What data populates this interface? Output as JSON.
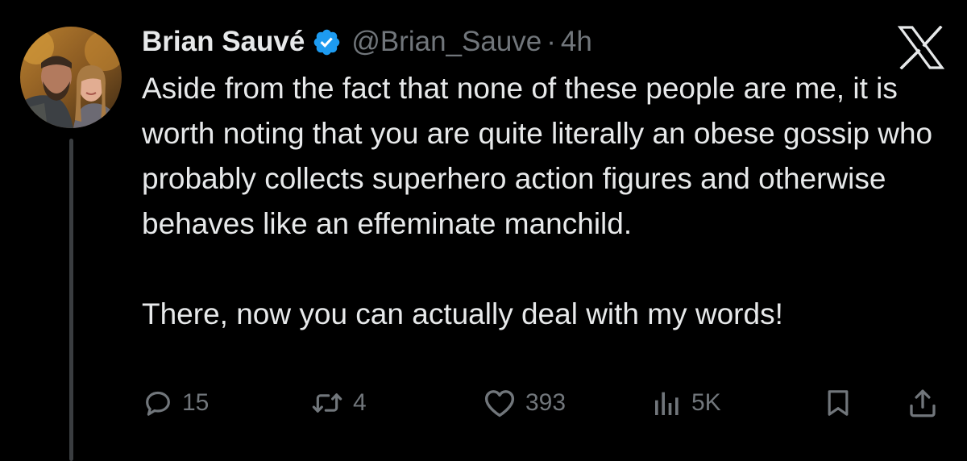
{
  "author": {
    "display_name": "Brian Sauvé",
    "handle": "@Brian_Sauve",
    "separator": "·",
    "timestamp": "4h",
    "verified_icon": "verified-badge-icon",
    "verified_color": "#1d9bf0"
  },
  "platform": {
    "logo_icon": "x-logo-icon"
  },
  "tweet": {
    "paragraphs": [
      "Aside from the fact that none of these people are me, it is worth noting that you are quite literally an obese gossip who probably collects superhero action figures and otherwise behaves like an effeminate manchild.",
      "There, now you can actually deal with my words!"
    ]
  },
  "actions": {
    "reply": {
      "icon": "reply-icon",
      "count": "15"
    },
    "repost": {
      "icon": "repost-icon",
      "count": "4"
    },
    "like": {
      "icon": "heart-icon",
      "count": "393"
    },
    "views": {
      "icon": "views-icon",
      "count": "5K"
    },
    "bookmark": {
      "icon": "bookmark-icon"
    },
    "share": {
      "icon": "share-icon"
    }
  },
  "colors": {
    "background": "#000000",
    "text": "#e7e9ea",
    "muted": "#71767b",
    "accent": "#1d9bf0"
  }
}
